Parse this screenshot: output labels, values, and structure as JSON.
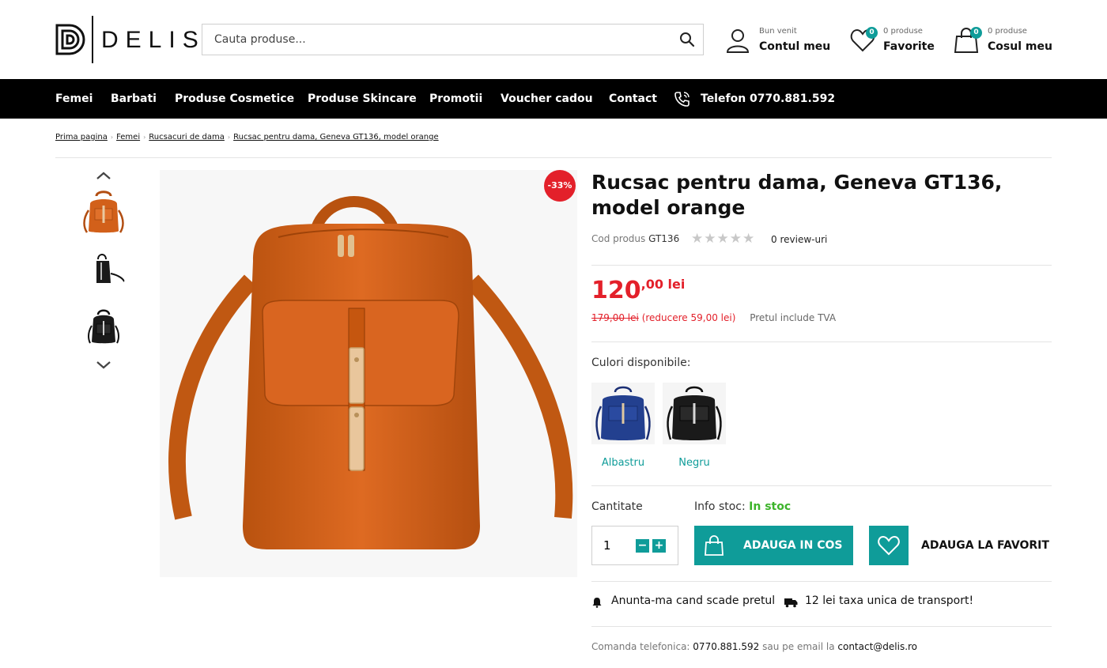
{
  "brand": {
    "name": "DELIS"
  },
  "search": {
    "placeholder": "Cauta produse..."
  },
  "header": {
    "account": {
      "small": "Bun venit",
      "big": "Contul meu"
    },
    "favorites": {
      "badge": "0",
      "small": "0 produse",
      "big": "Favorite"
    },
    "cart": {
      "badge": "0",
      "small": "0 produse",
      "big": "Cosul meu"
    }
  },
  "nav": {
    "items": [
      "Femei",
      "Barbati",
      "Produse Cosmetice",
      "Produse Skincare",
      "Promotii",
      "Voucher cadou",
      "Contact"
    ],
    "phone": "Telefon 0770.881.592"
  },
  "breadcrumb": [
    "Prima pagina",
    "Femei",
    "Rucsacuri de dama",
    "Rucsac pentru dama, Geneva GT136, model orange"
  ],
  "product": {
    "discount_badge": "-33%",
    "title": "Rucsac pentru dama, Geneva GT136, model orange",
    "code_label": "Cod produs",
    "code": "GT136",
    "reviews": "0 review-uri",
    "rating": 0,
    "price_int": "120",
    "price_dec": ",00 lei",
    "old_price": "179,00 lei",
    "reduction": "(reducere 59,00 lei)",
    "vat_note": "Pretul include TVA",
    "colors_label": "Culori disponibile:",
    "colors": [
      {
        "name": "Albastru",
        "hex": "#1f3a8a"
      },
      {
        "name": "Negru",
        "hex": "#1a1a1a"
      }
    ],
    "qty_label": "Cantitate",
    "qty_value": "1",
    "stock_label": "Info stoc:",
    "stock_value": "In stoc",
    "add_to_cart": "ADAUGA IN COS",
    "add_to_fav": "ADAUGA LA FAVORIT",
    "notify_price": "Anunta-ma cand scade pretul",
    "shipping": "12 lei taxa unica de transport!",
    "order_phone_label": "Comanda telefonica:",
    "order_phone": "0770.881.592",
    "order_email_label": "sau pe email la",
    "order_email": "contact@delis.ro",
    "thumbnails": [
      {
        "color": "orange",
        "hex": "#d2601a"
      },
      {
        "color": "black",
        "hex": "#1a1a1a"
      },
      {
        "color": "black",
        "hex": "#1a1a1a"
      }
    ],
    "main_color": "#d2601a"
  },
  "colors": {
    "accent": "#0f9c99",
    "sale": "#e3202a",
    "stock": "#3db42b",
    "nav_bg": "#000000"
  }
}
